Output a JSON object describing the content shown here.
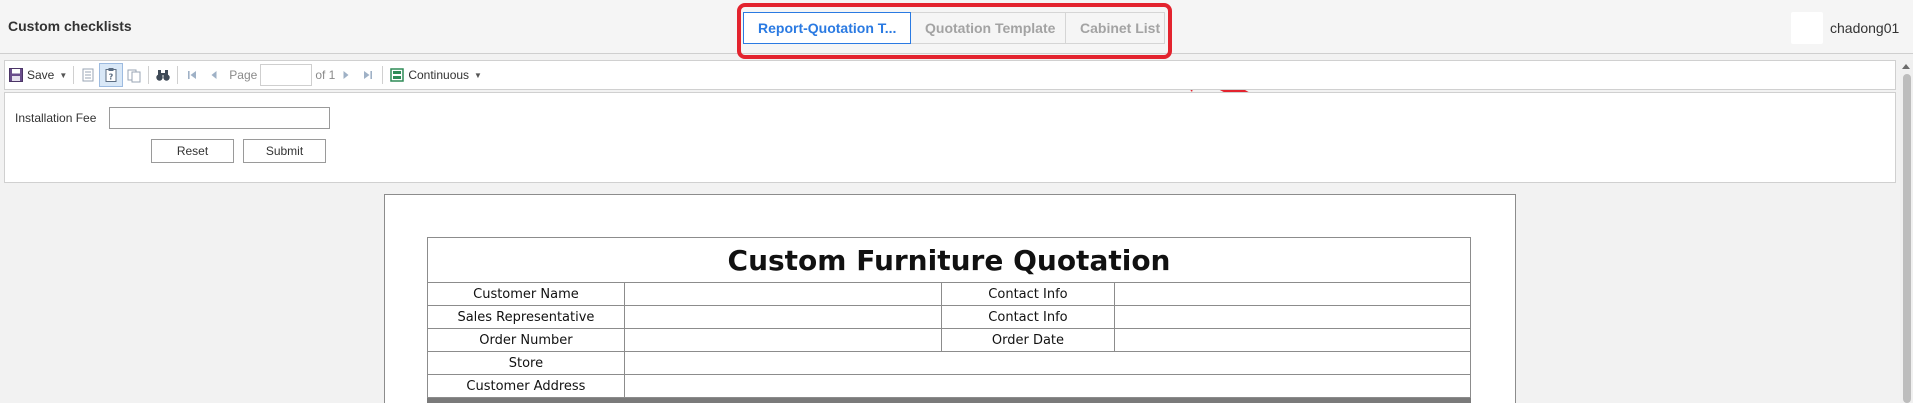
{
  "header": {
    "title": "Custom checklists",
    "tabs": [
      {
        "label": "Report-Quotation T...",
        "active": true
      },
      {
        "label": "Quotation Template",
        "active": false
      },
      {
        "label": "Cabinet List",
        "active": false
      }
    ],
    "username": "chadong01"
  },
  "toolbar": {
    "save_label": "Save",
    "page_label": "Page",
    "page_value": "",
    "of_label": "of 1",
    "view_mode": "Continuous"
  },
  "params": {
    "installation_fee_label": "Installation Fee",
    "installation_fee_value": "",
    "reset_label": "Reset",
    "submit_label": "Submit"
  },
  "report": {
    "title": "Custom Furniture Quotation",
    "fields": {
      "customer_name": "Customer Name",
      "contact_info_1": "Contact Info",
      "sales_rep": "Sales Representative",
      "contact_info_2": "Contact Info",
      "order_number": "Order Number",
      "order_date": "Order Date",
      "store": "Store",
      "customer_address": "Customer Address"
    }
  },
  "colors": {
    "accent": "#2a7ae2",
    "annotation": "#e3232e"
  }
}
